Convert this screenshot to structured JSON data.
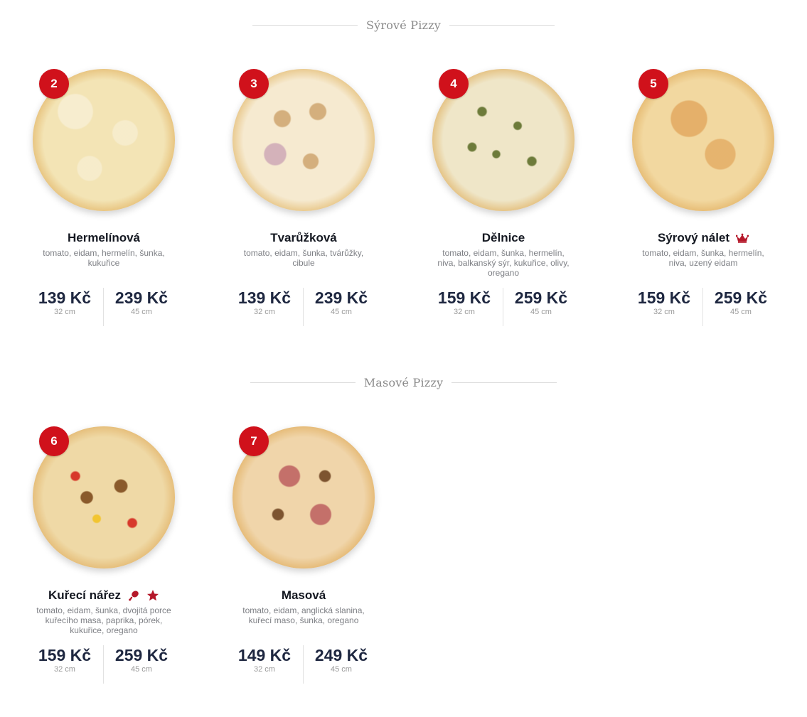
{
  "sections": [
    {
      "title": "Sýrové Pizzy",
      "items": [
        {
          "number": "2",
          "name": "Hermelínová",
          "ingredients": "tomato, eidam, hermelín, šunka, kukuřice",
          "price_small": "139 Kč",
          "size_small": "32 cm",
          "price_large": "239 Kč",
          "size_large": "45 cm",
          "icons": []
        },
        {
          "number": "3",
          "name": "Tvarůžková",
          "ingredients": "tomato, eidam, šunka, tvárůžky, cibule",
          "price_small": "139 Kč",
          "size_small": "32 cm",
          "price_large": "239 Kč",
          "size_large": "45 cm",
          "icons": []
        },
        {
          "number": "4",
          "name": "Dělnice",
          "ingredients": "tomato, eidam, šunka, hermelín, niva, balkanský sýr, kukuřice, olivy, oregano",
          "price_small": "159 Kč",
          "size_small": "32 cm",
          "price_large": "259 Kč",
          "size_large": "45 cm",
          "icons": []
        },
        {
          "number": "5",
          "name": "Sýrový nálet",
          "ingredients": "tomato, eidam, šunka, hermelín, niva, uzený eidam",
          "price_small": "159 Kč",
          "size_small": "32 cm",
          "price_large": "259 Kč",
          "size_large": "45 cm",
          "icons": [
            "crown-icon"
          ]
        }
      ]
    },
    {
      "title": "Masové Pizzy",
      "items": [
        {
          "number": "6",
          "name": "Kuřecí nářez",
          "ingredients": "tomato, eidam, šunka, dvojitá porce kuřecího masa, paprika, pórek, kukuřice, oregano",
          "price_small": "159 Kč",
          "size_small": "32 cm",
          "price_large": "259 Kč",
          "size_large": "45 cm",
          "icons": [
            "chicken-leg-icon",
            "star-icon"
          ]
        },
        {
          "number": "7",
          "name": "Masová",
          "ingredients": "tomato, eidam, anglická slanina, kuřecí maso, šunka, oregano",
          "price_small": "149 Kč",
          "size_small": "32 cm",
          "price_large": "249 Kč",
          "size_large": "45 cm",
          "icons": []
        }
      ]
    }
  ],
  "colors": {
    "badge": "#d0111b",
    "icon_red": "#b5182a",
    "price_text": "#1e2740",
    "heading_text": "#8a8a8a"
  }
}
